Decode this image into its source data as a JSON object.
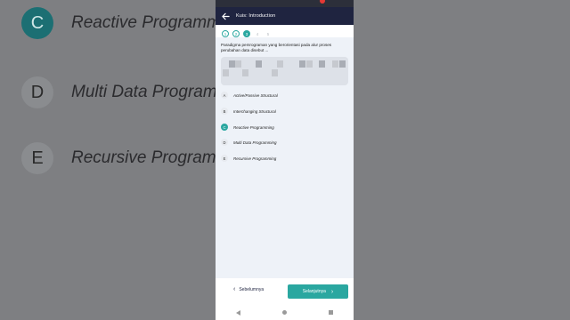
{
  "background_options": [
    {
      "letter": "C",
      "label": "Reactive Programming",
      "selected": true
    },
    {
      "letter": "D",
      "label": "Multi Data Programming",
      "selected": false
    },
    {
      "letter": "E",
      "label": "Recursive Programming",
      "selected": false
    }
  ],
  "appbar": {
    "title": "Kuis:  Introduction"
  },
  "steps": [
    {
      "number": "1",
      "state": "done"
    },
    {
      "number": "2",
      "state": "done"
    },
    {
      "number": "3",
      "state": "current"
    },
    {
      "number": "4",
      "state": "todo"
    },
    {
      "number": "5",
      "state": "todo"
    }
  ],
  "question": {
    "text": "Paradigma pemrograman yang berorientasi pada alur proses perubahan data disebut ..."
  },
  "options": [
    {
      "letter": "A",
      "label": "Active/Passive Structural",
      "selected": false
    },
    {
      "letter": "B",
      "label": "Interchanging Structural",
      "selected": false
    },
    {
      "letter": "C",
      "label": "Reactive Programming",
      "selected": true
    },
    {
      "letter": "D",
      "label": "Multi Data Programming",
      "selected": false
    },
    {
      "letter": "E",
      "label": "Recursive Programming",
      "selected": false
    }
  ],
  "footer": {
    "prev_label": "Sebelumnya",
    "next_label": "Selanjutnya"
  },
  "colors": {
    "accent": "#2aa7a0",
    "appbar": "#1f2440"
  }
}
